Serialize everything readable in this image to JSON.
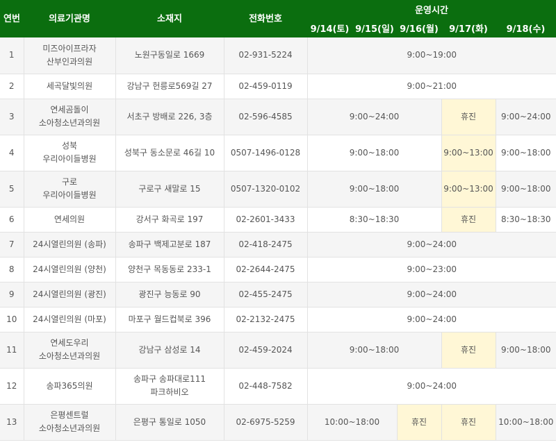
{
  "headers": {
    "no": "연번",
    "name": "의료기관명",
    "address": "소재지",
    "phone": "전화번호",
    "hours": "운영시간",
    "days": [
      "9/14(토)",
      "9/15(일)",
      "9/16(월)",
      "9/17(화)",
      "9/18(수)"
    ]
  },
  "rows": [
    {
      "no": "1",
      "name": [
        "미즈아이프라자",
        "산부인과의원"
      ],
      "address": [
        "노원구동일로 1669"
      ],
      "phone": "02-931-5224",
      "hours": [
        {
          "text": "9:00~19:00",
          "span": 5
        }
      ]
    },
    {
      "no": "2",
      "name": [
        "세곡달빛의원"
      ],
      "address": [
        "강남구 헌릉로569길 27"
      ],
      "phone": "02-459-0119",
      "hours": [
        {
          "text": "9:00~21:00",
          "span": 5
        }
      ]
    },
    {
      "no": "3",
      "name": [
        "연세곰돌이",
        "소아청소년과의원"
      ],
      "address": [
        "서초구 방배로 226, 3층"
      ],
      "phone": "02-596-4585",
      "hours": [
        {
          "text": "9:00~24:00",
          "span": 3
        },
        {
          "text": "휴진",
          "span": 1,
          "closed": true
        },
        {
          "text": "9:00~24:00",
          "span": 1
        }
      ]
    },
    {
      "no": "4",
      "name": [
        "성북",
        "우리아이들병원"
      ],
      "address": [
        "성북구 동소문로 46길 10"
      ],
      "phone": "0507-1496-0128",
      "hours": [
        {
          "text": "9:00~18:00",
          "span": 3
        },
        {
          "text": "9:00~13:00",
          "span": 1,
          "closed": true
        },
        {
          "text": "9:00~18:00",
          "span": 1
        }
      ]
    },
    {
      "no": "5",
      "name": [
        "구로",
        "우리아이들병원"
      ],
      "address": [
        "구로구 새말로 15"
      ],
      "phone": "0507-1320-0102",
      "hours": [
        {
          "text": "9:00~18:00",
          "span": 3
        },
        {
          "text": "9:00~13:00",
          "span": 1,
          "closed": true
        },
        {
          "text": "9:00~18:00",
          "span": 1
        }
      ]
    },
    {
      "no": "6",
      "name": [
        "연세의원"
      ],
      "address": [
        "강서구 화곡로 197"
      ],
      "phone": "02-2601-3433",
      "hours": [
        {
          "text": "8:30~18:30",
          "span": 3
        },
        {
          "text": "휴진",
          "span": 1,
          "closed": true
        },
        {
          "text": "8:30~18:30",
          "span": 1
        }
      ]
    },
    {
      "no": "7",
      "name": [
        "24시열린의원 (송파)"
      ],
      "address": [
        "송파구 백제고분로 187"
      ],
      "phone": "02-418-2475",
      "hours": [
        {
          "text": "9:00~24:00",
          "span": 5
        }
      ]
    },
    {
      "no": "8",
      "name": [
        "24시열린의원 (양천)"
      ],
      "address": [
        "양천구 목동동로 233-1"
      ],
      "phone": "02-2644-2475",
      "hours": [
        {
          "text": "9:00~23:00",
          "span": 5
        }
      ]
    },
    {
      "no": "9",
      "name": [
        "24시열린의원 (광진)"
      ],
      "address": [
        "광진구 능동로 90"
      ],
      "phone": "02-455-2475",
      "hours": [
        {
          "text": "9:00~24:00",
          "span": 5
        }
      ]
    },
    {
      "no": "10",
      "name": [
        "24시열린의원 (마포)"
      ],
      "address": [
        "마포구 월드컵북로 396"
      ],
      "phone": "02-2132-2475",
      "hours": [
        {
          "text": "9:00~24:00",
          "span": 5
        }
      ]
    },
    {
      "no": "11",
      "name": [
        "연세도우리",
        "소아청소년과의원"
      ],
      "address": [
        "강남구 삼성로 14"
      ],
      "phone": "02-459-2024",
      "hours": [
        {
          "text": "9:00~18:00",
          "span": 3
        },
        {
          "text": "휴진",
          "span": 1,
          "closed": true
        },
        {
          "text": "9:00~18:00",
          "span": 1
        }
      ]
    },
    {
      "no": "12",
      "name": [
        "송파365의원"
      ],
      "address": [
        "송파구 송파대로111",
        "파크하비오"
      ],
      "phone": "02-448-7582",
      "hours": [
        {
          "text": "9:00~24:00",
          "span": 5
        }
      ]
    },
    {
      "no": "13",
      "name": [
        "은평센트럴",
        "소아청소년과의원"
      ],
      "address": [
        "은평구 통일로 1050"
      ],
      "phone": "02-6975-5259",
      "hours": [
        {
          "text": "10:00~18:00",
          "span": 2
        },
        {
          "text": "휴진",
          "span": 1,
          "closed": true
        },
        {
          "text": "휴진",
          "span": 1,
          "closed": true
        },
        {
          "text": "10:00~18:00",
          "span": 1
        }
      ]
    }
  ]
}
